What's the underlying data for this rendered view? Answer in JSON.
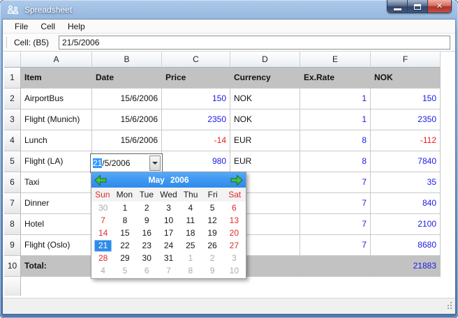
{
  "window": {
    "title": "Spreadsheet"
  },
  "icons": {
    "app": "two-figures-app-icon",
    "minimize": "minimize-icon",
    "maximize": "maximize-icon",
    "close": "close-icon",
    "prev_month": "green-left-arrow-icon",
    "next_month": "green-right-arrow-icon",
    "combo_dropdown": "down-triangle-icon",
    "resize_grip": "grip-dots-icon"
  },
  "menu": {
    "items": [
      "File",
      "Cell",
      "Help"
    ]
  },
  "toolbar": {
    "label": "Cell: (B5)",
    "value": "21/5/2006"
  },
  "sheet": {
    "col_letters": [
      "A",
      "B",
      "C",
      "D",
      "E",
      "F"
    ],
    "row_numbers": [
      "1",
      "2",
      "3",
      "4",
      "5",
      "6",
      "7",
      "8",
      "9",
      "10"
    ],
    "header_row": {
      "item": "Item",
      "date": "Date",
      "price": "Price",
      "currency": "Currency",
      "rate": "Ex.Rate",
      "nok": "NOK"
    },
    "rows": [
      {
        "item": "AirportBus",
        "date": "15/6/2006",
        "price": "150",
        "pc": "blue",
        "currency": "NOK",
        "rate": "1",
        "nok": "150",
        "nc": "blue"
      },
      {
        "item": "Flight (Munich)",
        "date": "15/6/2006",
        "price": "2350",
        "pc": "blue",
        "currency": "NOK",
        "rate": "1",
        "nok": "2350",
        "nc": "blue"
      },
      {
        "item": "Lunch",
        "date": "15/6/2006",
        "price": "-14",
        "pc": "red",
        "currency": "EUR",
        "rate": "8",
        "nok": "-112",
        "nc": "red"
      },
      {
        "item": "Flight (LA)",
        "date": "",
        "price": "980",
        "pc": "blue",
        "currency": "EUR",
        "rate": "8",
        "nok": "7840",
        "nc": "blue"
      },
      {
        "item": "Taxi",
        "date": "",
        "price": "",
        "pc": "",
        "currency": "",
        "rate": "7",
        "nok": "35",
        "nc": "blue"
      },
      {
        "item": "Dinner",
        "date": "",
        "price": "",
        "pc": "",
        "currency": "",
        "rate": "7",
        "nok": "840",
        "nc": "blue"
      },
      {
        "item": "Hotel",
        "date": "",
        "price": "",
        "pc": "",
        "currency": "",
        "rate": "7",
        "nok": "2100",
        "nc": "blue"
      },
      {
        "item": "Flight (Oslo)",
        "date": "",
        "price": "",
        "pc": "",
        "currency": "",
        "rate": "7",
        "nok": "8680",
        "nc": "blue"
      }
    ],
    "total_row": {
      "label": "Total:",
      "value": "21883",
      "vc": "blue"
    }
  },
  "combo": {
    "selected": "21",
    "rest": "/5/2006"
  },
  "calendar": {
    "month": "May",
    "year": "2006",
    "day_names": [
      {
        "n": "Sun",
        "t": "we"
      },
      {
        "n": "Mon",
        "t": "wd"
      },
      {
        "n": "Tue",
        "t": "wd"
      },
      {
        "n": "Wed",
        "t": "wd"
      },
      {
        "n": "Thu",
        "t": "wd"
      },
      {
        "n": "Fri",
        "t": "wd"
      },
      {
        "n": "Sat",
        "t": "we"
      }
    ],
    "weeks": [
      [
        {
          "d": "30",
          "t": "out"
        },
        {
          "d": "1",
          "t": "wd"
        },
        {
          "d": "2",
          "t": "wd"
        },
        {
          "d": "3",
          "t": "wd"
        },
        {
          "d": "4",
          "t": "wd"
        },
        {
          "d": "5",
          "t": "wd"
        },
        {
          "d": "6",
          "t": "we"
        }
      ],
      [
        {
          "d": "7",
          "t": "we"
        },
        {
          "d": "8",
          "t": "wd"
        },
        {
          "d": "9",
          "t": "wd"
        },
        {
          "d": "10",
          "t": "wd"
        },
        {
          "d": "11",
          "t": "wd"
        },
        {
          "d": "12",
          "t": "wd"
        },
        {
          "d": "13",
          "t": "we"
        }
      ],
      [
        {
          "d": "14",
          "t": "we"
        },
        {
          "d": "15",
          "t": "wd"
        },
        {
          "d": "16",
          "t": "wd"
        },
        {
          "d": "17",
          "t": "wd"
        },
        {
          "d": "18",
          "t": "wd"
        },
        {
          "d": "19",
          "t": "wd"
        },
        {
          "d": "20",
          "t": "we"
        }
      ],
      [
        {
          "d": "21",
          "t": "sel"
        },
        {
          "d": "22",
          "t": "wd"
        },
        {
          "d": "23",
          "t": "wd"
        },
        {
          "d": "24",
          "t": "wd"
        },
        {
          "d": "25",
          "t": "wd"
        },
        {
          "d": "26",
          "t": "wd"
        },
        {
          "d": "27",
          "t": "we"
        }
      ],
      [
        {
          "d": "28",
          "t": "we"
        },
        {
          "d": "29",
          "t": "wd"
        },
        {
          "d": "30",
          "t": "wd"
        },
        {
          "d": "31",
          "t": "wd"
        },
        {
          "d": "1",
          "t": "out"
        },
        {
          "d": "2",
          "t": "out"
        },
        {
          "d": "3",
          "t": "out"
        }
      ],
      [
        {
          "d": "4",
          "t": "out"
        },
        {
          "d": "5",
          "t": "out"
        },
        {
          "d": "6",
          "t": "out"
        },
        {
          "d": "7",
          "t": "out"
        },
        {
          "d": "8",
          "t": "out"
        },
        {
          "d": "9",
          "t": "out"
        },
        {
          "d": "10",
          "t": "out"
        }
      ]
    ]
  },
  "colors": {
    "accent_blue": "#3399FF",
    "calendar_header_blue": "#3E97F2",
    "value_blue": "#1A1AE6",
    "value_red": "#F01818",
    "header_gray": "#C2C2C2",
    "arrow_green": "#3FBF4A"
  }
}
